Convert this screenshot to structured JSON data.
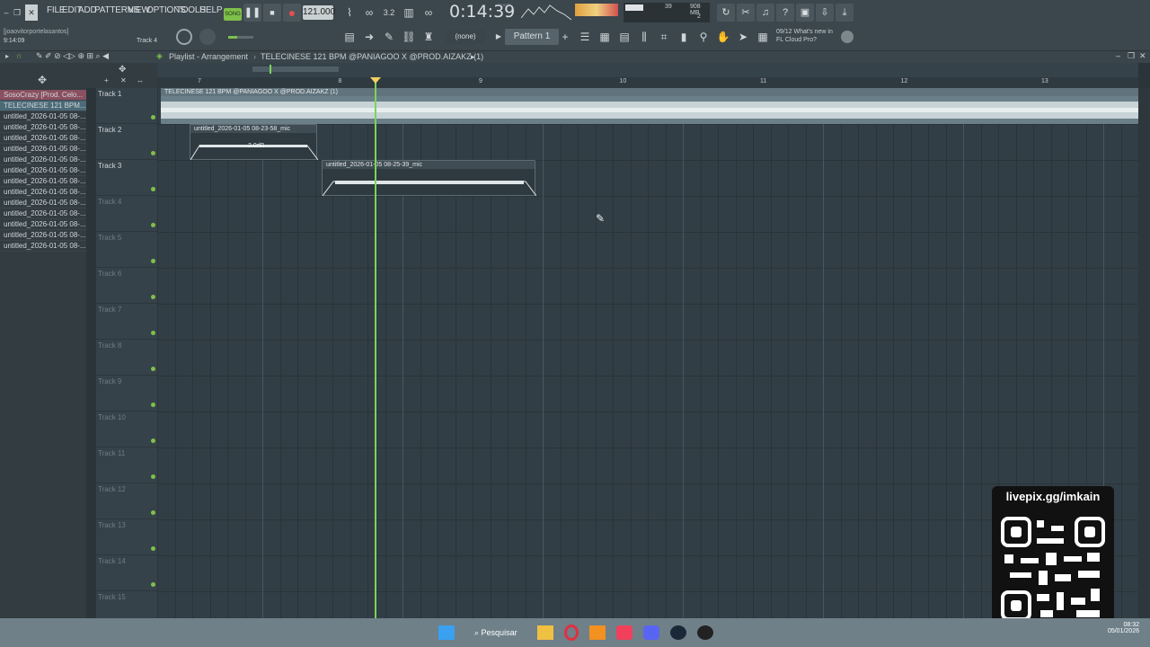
{
  "menu": [
    "FILE",
    "EDIT",
    "ADD",
    "PATTERNS",
    "VIEW",
    "OPTIONS",
    "TOOLS",
    "HELP"
  ],
  "transport": {
    "mode": "SONG",
    "tempo": "121.000",
    "time": "0:14:39",
    "time_unit": "M:S:CS"
  },
  "meters": {
    "cpu": "39",
    "mem": "908 MB",
    "voices": "2"
  },
  "hint": {
    "user": "[joaovitorportelasantos]",
    "pos": "9:14:09",
    "track": "Track 4"
  },
  "snap": "(none)",
  "pattern": "Pattern 1",
  "news": {
    "date": "09/12",
    "text": "What's new in FL Cloud Pro?"
  },
  "playlist": {
    "title": "Playlist - Arrangement",
    "song": "TELECINESE 121 BPM @PANIAGOO X @PROD.AIZAKZ (1)"
  },
  "browser_items": [
    "SosoCrazy [Prod. Celo...",
    "TELECINESE 121 BPM...",
    "untitled_2026-01-05 08-...",
    "untitled_2026-01-05 08-...",
    "untitled_2026-01-05 08-...",
    "untitled_2026-01-05 08-...",
    "untitled_2026-01-05 08-...",
    "untitled_2026-01-05 08-...",
    "untitled_2026-01-05 08-...",
    "untitled_2026-01-05 08-...",
    "untitled_2026-01-05 08-...",
    "untitled_2026-01-05 08-...",
    "untitled_2026-01-05 08-...",
    "untitled_2026-01-05 08-...",
    "untitled_2026-01-05 08-..."
  ],
  "tracks": [
    "Track 1",
    "Track 2",
    "Track 3",
    "Track 4",
    "Track 5",
    "Track 6",
    "Track 7",
    "Track 8",
    "Track 9",
    "Track 10",
    "Track 11",
    "Track 12",
    "Track 13",
    "Track 14",
    "Track 15"
  ],
  "ruler": [
    "7",
    "8",
    "9",
    "10",
    "11",
    "12",
    "13"
  ],
  "clips": {
    "c1": "TELECINESE 121 BPM @PANIAGOO X @PROD.AIZAKZ (1)",
    "c2": "untitled_2026-01-05 08-23-58_mic",
    "c2gain": "2.0dB",
    "c3": "untitled_2026-01-05 08-25-39_mic"
  },
  "overlay": {
    "site": "livepix.gg/imkain"
  },
  "taskbar": {
    "search": "Pesquisar",
    "time": "08:32",
    "date": "05/01/2026"
  }
}
